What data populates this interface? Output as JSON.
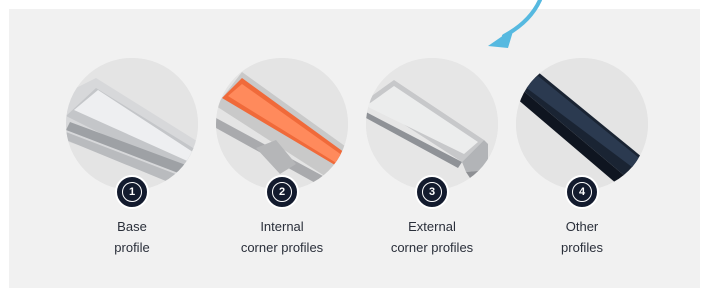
{
  "colors": {
    "panel_bg": "#f1f1f1",
    "circle_bg": "#e3e3e3",
    "badge_bg": "#131b2e",
    "arrow": "#56b9e0",
    "text": "#2a2f3a"
  },
  "profiles": [
    {
      "number": "1",
      "label_line1": "Base",
      "label_line2": "profile",
      "image": "aluminium-base-profile"
    },
    {
      "number": "2",
      "label_line1": "Internal",
      "label_line2": "corner profiles",
      "image": "internal-corner-profile-orange"
    },
    {
      "number": "3",
      "label_line1": "External",
      "label_line2": "corner profiles",
      "image": "external-corner-profile-aluminium"
    },
    {
      "number": "4",
      "label_line1": "Other",
      "label_line2": "profiles",
      "image": "black-profile"
    }
  ]
}
